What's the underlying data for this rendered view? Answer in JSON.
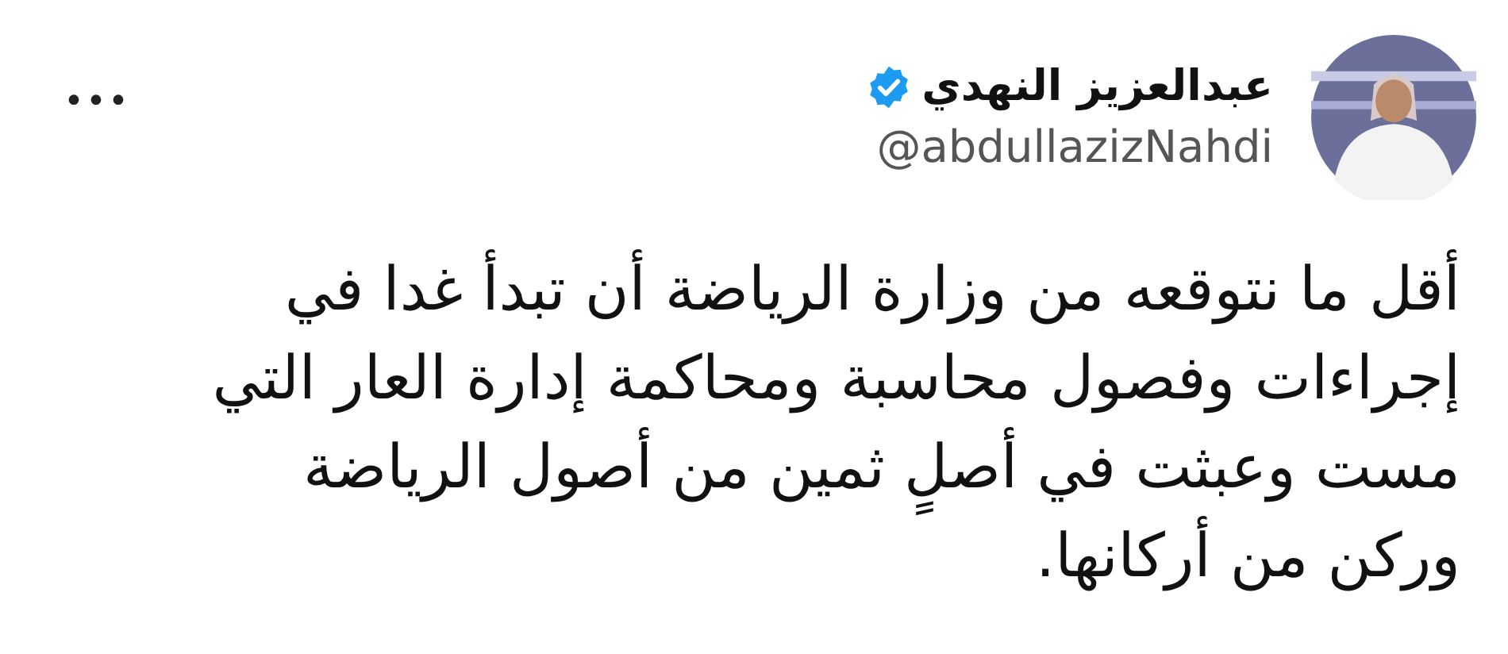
{
  "author": {
    "name": "عبدالعزيز النهدي",
    "verified": true,
    "handle": "@abdullazizNahdi"
  },
  "more_menu": "•••",
  "post": {
    "text": "أقل ما نتوقعه من وزارة الرياضة أن تبدأ غدا في\nإجراءات وفصول محاسبة ومحاكمة إدارة العار التي\nمست وعبثت في أصلٍ ثمين من أصول الرياضة\nوركن من أركانها."
  }
}
